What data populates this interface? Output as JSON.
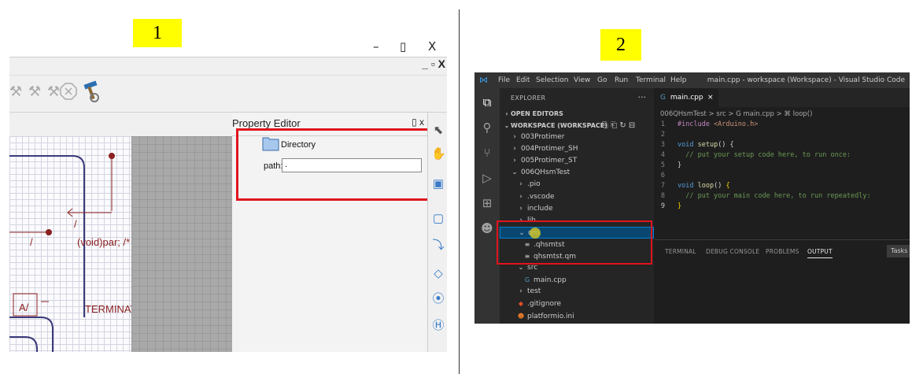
{
  "badges": {
    "one": "1",
    "two": "2"
  },
  "qm": {
    "window_controls": {
      "minimize": "–",
      "maximize": "▯",
      "close": "X"
    },
    "menubar_controls": "_ ▫ X",
    "canvas_labels": {
      "action": "(void)par; /*",
      "terminate": "TERMINATE",
      "a_label": "A/",
      "slash1": "/",
      "slash2": "/"
    },
    "property_editor": {
      "title": "Property Editor",
      "title_controls": "▯ x",
      "directory_label": "Directory",
      "path_label": "path:",
      "path_value": "."
    }
  },
  "vscode": {
    "menu": [
      "File",
      "Edit",
      "Selection",
      "View",
      "Go",
      "Run",
      "Terminal",
      "Help"
    ],
    "window_title": "main.cpp - workspace (Workspace) - Visual Studio Code",
    "explorer": {
      "header": "EXPLORER",
      "dots": "···",
      "open_editors": "OPEN EDITORS",
      "workspace": "WORKSPACE (WORKSPACE)",
      "items": [
        {
          "label": "003Protimer",
          "chev": "›",
          "ico": ""
        },
        {
          "label": "004Protimer_SH",
          "chev": "›",
          "ico": ""
        },
        {
          "label": "005Protimer_ST",
          "chev": "›",
          "ico": ""
        },
        {
          "label": "006QHsmTest",
          "chev": "⌄",
          "ico": ""
        },
        {
          "label": ".pio",
          "chev": "›",
          "ico": ""
        },
        {
          "label": ".vscode",
          "chev": "›",
          "ico": ""
        },
        {
          "label": "include",
          "chev": "›",
          "ico": ""
        },
        {
          "label": "lib",
          "chev": "›",
          "ico": ""
        },
        {
          "label": "qm",
          "chev": "⌄",
          "ico": ""
        },
        {
          "label": ".qhsmtst",
          "chev": "",
          "ico": "≡"
        },
        {
          "label": "qhsmtst.qm",
          "chev": "",
          "ico": "≡"
        },
        {
          "label": "src",
          "chev": "⌄",
          "ico": ""
        },
        {
          "label": "main.cpp",
          "chev": "",
          "ico": "G"
        },
        {
          "label": "test",
          "chev": "›",
          "ico": ""
        },
        {
          "label": ".gitignore",
          "chev": "",
          "ico": "◆"
        },
        {
          "label": "platformio.ini",
          "chev": "",
          "ico": "☻"
        }
      ]
    },
    "tab": {
      "label": "main.cpp",
      "close": "×"
    },
    "breadcrumb": "006QHsmTest > src > G main.cpp > ⌘ loop()",
    "code": [
      {
        "n": "1",
        "parts": [
          [
            "k-inc",
            "#include "
          ],
          [
            "k-str",
            "<Arduino.h>"
          ]
        ]
      },
      {
        "n": "2",
        "parts": []
      },
      {
        "n": "3",
        "parts": [
          [
            "k-type",
            "void "
          ],
          [
            "k-fn",
            "setup"
          ],
          [
            "k-pun",
            "() {"
          ]
        ]
      },
      {
        "n": "4",
        "parts": [
          [
            "k-cmt",
            "  // put your setup code here, to run once:"
          ]
        ]
      },
      {
        "n": "5",
        "parts": [
          [
            "k-pun",
            "}"
          ]
        ]
      },
      {
        "n": "6",
        "parts": []
      },
      {
        "n": "7",
        "parts": [
          [
            "k-type",
            "void "
          ],
          [
            "k-fn",
            "loop"
          ],
          [
            "k-pun",
            "() "
          ],
          [
            "k-brk",
            "{"
          ]
        ]
      },
      {
        "n": "8",
        "parts": [
          [
            "k-cmt",
            "  // put your main code here, to run repeatedly:"
          ]
        ]
      },
      {
        "n": "9",
        "parts": [
          [
            "k-brk",
            "}"
          ]
        ]
      }
    ],
    "panel_tabs": [
      "TERMINAL",
      "DEBUG CONSOLE",
      "PROBLEMS",
      "OUTPUT"
    ],
    "panel_active": "OUTPUT",
    "tasks": "Tasks"
  }
}
